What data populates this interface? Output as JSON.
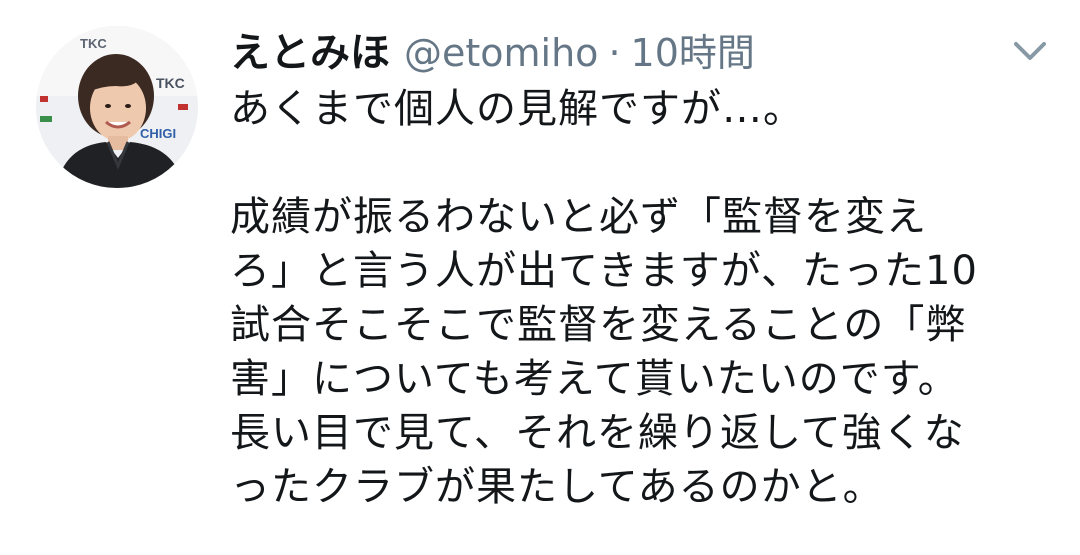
{
  "tweet": {
    "author": {
      "display_name": "えとみほ",
      "handle": "@etomiho",
      "separator": "·",
      "timestamp": "10時間"
    },
    "avatar": {
      "backdrop_text": [
        "TKC",
        "TKC",
        "CHIGI"
      ]
    },
    "menu_icon": "chevron-down-icon",
    "text_lines": [
      "あくまで個人の見解ですが…。",
      "",
      "成績が振るわないと必ず「監督を変え",
      "ろ」と言う人が出てきますが、たった10",
      "試合そこそこで監督を変えることの「弊",
      "害」についても考えて貰いたいのです。",
      "長い目で見て、それを繰り返して強くな",
      "ったクラブが果たしてあるのかと。"
    ]
  },
  "colors": {
    "text": "#14171a",
    "secondary": "#657786",
    "background": "#ffffff"
  }
}
